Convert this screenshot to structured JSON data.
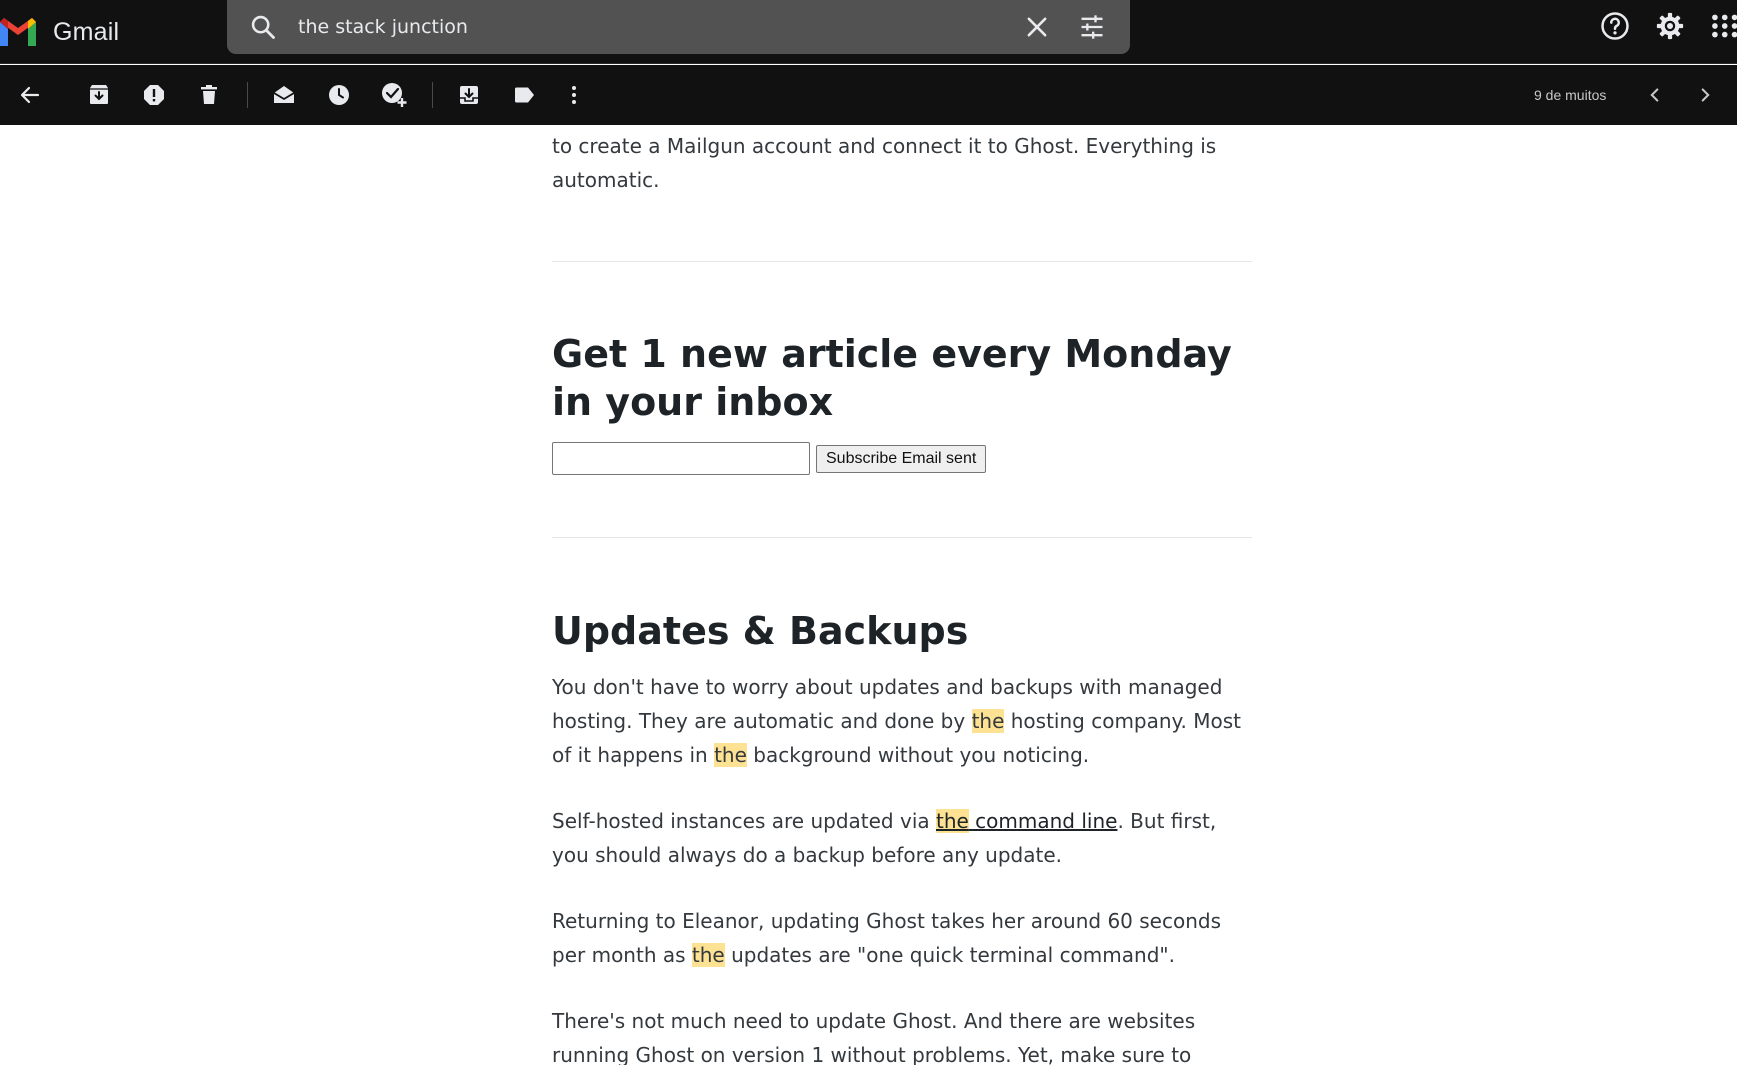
{
  "header": {
    "app_name": "Gmail",
    "search": {
      "value": "the stack junction"
    }
  },
  "toolbar": {
    "pager": "9 de muitos"
  },
  "email": {
    "intro_paragraph": "to create a Mailgun account and connect it to Ghost. Everything is automatic.",
    "subscribe": {
      "heading": "Get 1 new article every Monday in your inbox",
      "input_value": "",
      "button_label": "Subscribe Email sent"
    },
    "section": {
      "heading": "Updates & Backups",
      "p1": {
        "a": "You don't have to worry about updates and backups with managed hosting. They are automatic and done by ",
        "hl1": "the",
        "b": " hosting company. Most of it happens in ",
        "hl2": "the",
        "c": " background without you noticing."
      },
      "p2": {
        "a": "Self-hosted instances are updated via ",
        "link_hl": "the",
        "link_rest": " command line",
        "b": ". But first, you should always do a backup before any update."
      },
      "p3": {
        "a": "Returning to Eleanor, updating Ghost takes her around 60 seconds per month as ",
        "hl": "the",
        "b": " updates are \"one quick terminal command\"."
      },
      "p4": "There's not much need to update Ghost. And there are websites running Ghost on version 1 without problems. Yet, make sure to update every time"
    },
    "highlight_color": "#fde293"
  },
  "icons": {
    "header": [
      "gmail-logo-icon",
      "search-icon",
      "clear-search-icon",
      "search-options-icon",
      "help-icon",
      "settings-icon",
      "apps-icon"
    ],
    "toolbar": [
      "back-arrow-icon",
      "archive-icon",
      "report-spam-icon",
      "delete-icon",
      "mark-unread-icon",
      "snooze-icon",
      "add-to-tasks-icon",
      "move-to-icon",
      "label-icon",
      "more-vert-icon",
      "chevron-left-icon",
      "chevron-right-icon"
    ]
  }
}
